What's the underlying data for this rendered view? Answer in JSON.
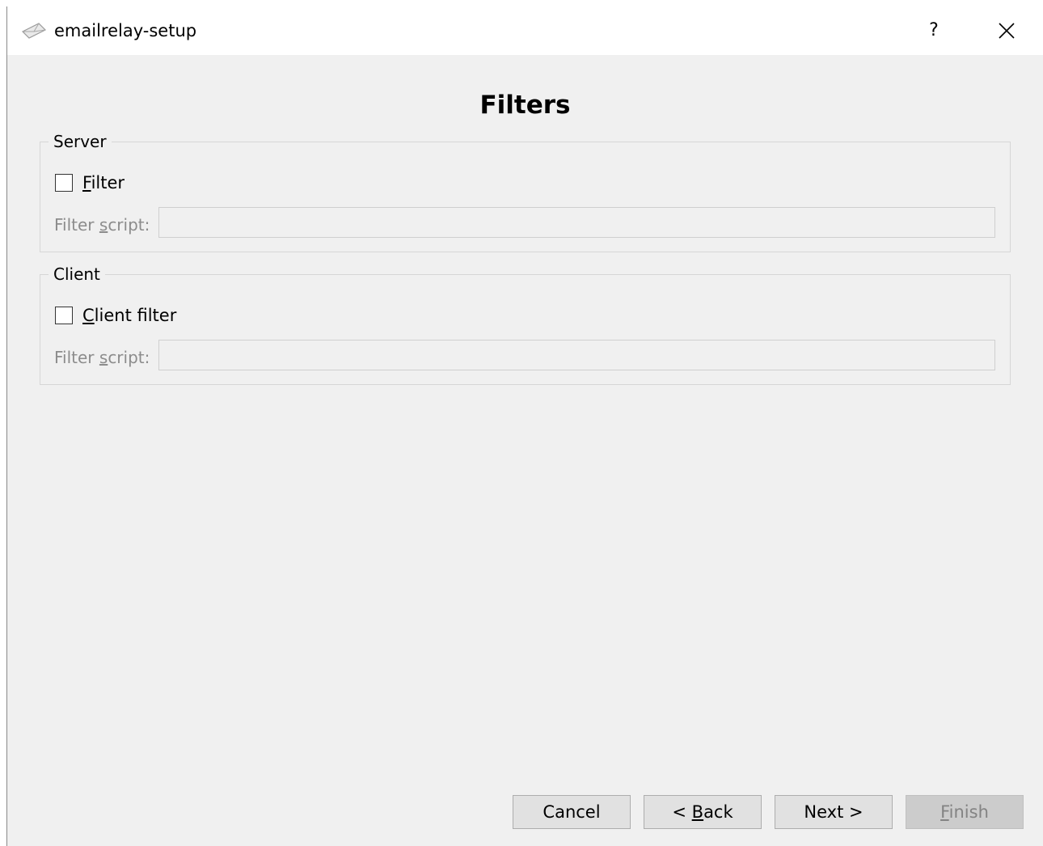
{
  "window": {
    "title": "emailrelay-setup",
    "help_label": "?"
  },
  "page": {
    "title": "Filters"
  },
  "server_group": {
    "title": "Server",
    "checkbox": {
      "mnemonic": "F",
      "rest": "ilter",
      "checked": false
    },
    "script_label": {
      "pre": "Filter ",
      "mnemonic": "s",
      "post": "cript:"
    },
    "script_value": ""
  },
  "client_group": {
    "title": "Client",
    "checkbox": {
      "mnemonic": "C",
      "rest": "lient filter",
      "checked": false
    },
    "script_label": {
      "pre": "Filter ",
      "mnemonic": "s",
      "post": "cript:"
    },
    "script_value": ""
  },
  "buttons": {
    "cancel": "Cancel",
    "back": {
      "pre": "< ",
      "mnemonic": "B",
      "post": "ack"
    },
    "next": "Next >",
    "finish": {
      "mnemonic": "F",
      "post": "inish"
    }
  }
}
